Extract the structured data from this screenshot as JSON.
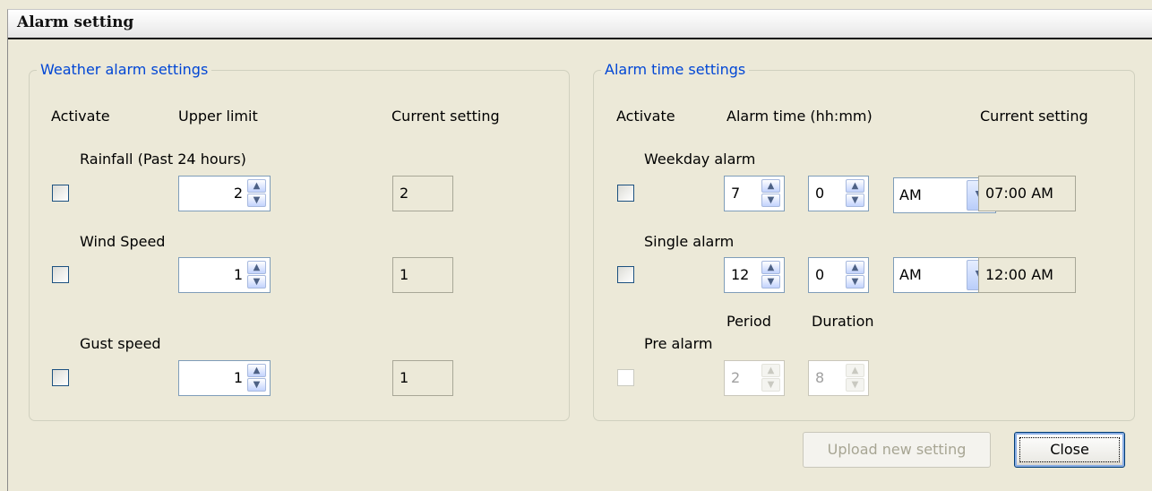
{
  "window": {
    "title": "Alarm setting"
  },
  "weather": {
    "legend": "Weather alarm settings",
    "headers": {
      "activate": "Activate",
      "upper_limit": "Upper limit",
      "current": "Current setting"
    },
    "rainfall": {
      "label": "Rainfall (Past 24 hours)",
      "value": "2",
      "current": "2",
      "checked": false
    },
    "wind": {
      "label": "Wind Speed",
      "value": "1",
      "current": "1",
      "checked": false
    },
    "gust": {
      "label": "Gust speed",
      "value": "1",
      "current": "1",
      "checked": false
    }
  },
  "alarm": {
    "legend": "Alarm time settings",
    "headers": {
      "activate": "Activate",
      "alarm_time": "Alarm time (hh:mm)",
      "current": "Current setting"
    },
    "weekday": {
      "label": "Weekday alarm",
      "hour": "7",
      "minute": "0",
      "ampm": "AM",
      "current": "07:00 AM",
      "checked": false
    },
    "single": {
      "label": "Single alarm",
      "hour": "12",
      "minute": "0",
      "ampm": "AM",
      "current": "12:00 AM",
      "checked": false
    },
    "pre": {
      "label": "Pre alarm",
      "period_label": "Period",
      "duration_label": "Duration",
      "period": "2",
      "duration": "8",
      "enabled": false
    }
  },
  "buttons": {
    "upload": "Upload new setting",
    "close": "Close"
  },
  "icons": {
    "spin_up": "up-arrow-icon",
    "spin_down": "down-arrow-icon",
    "dropdown": "chevron-down-icon"
  }
}
